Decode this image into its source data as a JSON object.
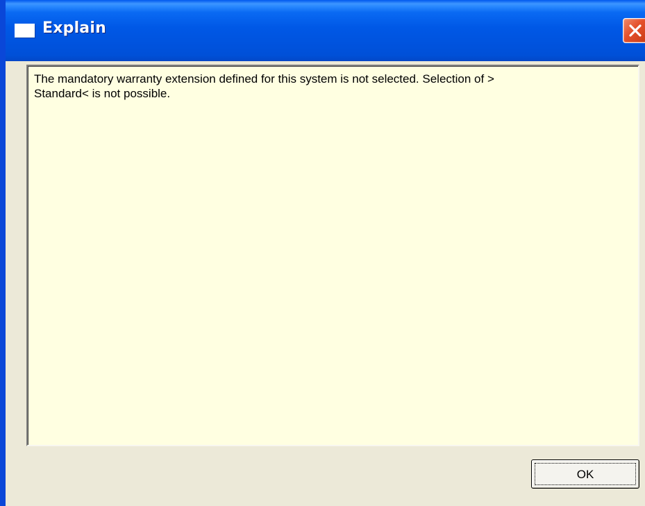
{
  "window": {
    "title": "Explain",
    "title_icon": "window-icon",
    "close_icon": "close-icon",
    "colors": {
      "titlebar": "#0058E6",
      "frame": "#0A47D8",
      "dialog_bg": "#ECE9D8",
      "message_bg": "#FFFFE1",
      "close_button": "#E4502A"
    }
  },
  "message": {
    "text": "The mandatory warranty extension defined for this system is not selected. Selection of >\nStandard< is not possible."
  },
  "buttons": {
    "ok_label": "OK"
  }
}
